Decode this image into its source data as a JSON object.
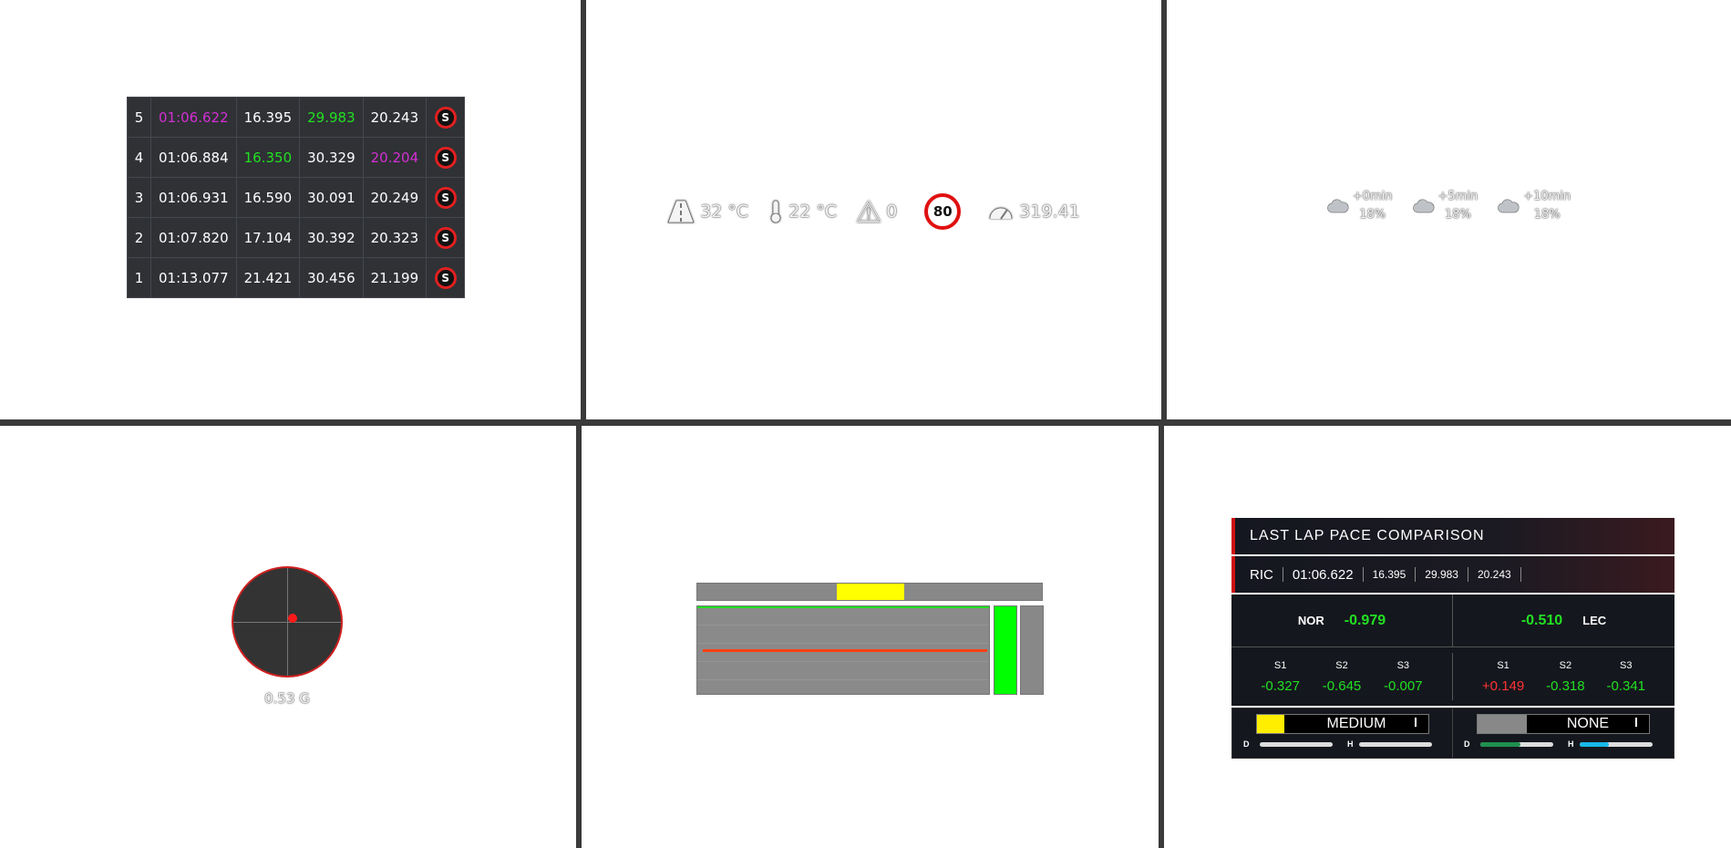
{
  "lap_table": {
    "rows": [
      {
        "lap": "5",
        "time": "01:06.622",
        "s1": "16.395",
        "s2": "29.983",
        "s3": "20.243",
        "time_class": "purple",
        "s1_class": "",
        "s2_class": "green",
        "s3_class": "",
        "tyre": "S"
      },
      {
        "lap": "4",
        "time": "01:06.884",
        "s1": "16.350",
        "s2": "30.329",
        "s3": "20.204",
        "time_class": "",
        "s1_class": "green",
        "s2_class": "",
        "s3_class": "purple",
        "tyre": "S"
      },
      {
        "lap": "3",
        "time": "01:06.931",
        "s1": "16.590",
        "s2": "30.091",
        "s3": "20.249",
        "time_class": "",
        "s1_class": "",
        "s2_class": "",
        "s3_class": "",
        "tyre": "S"
      },
      {
        "lap": "2",
        "time": "01:07.820",
        "s1": "17.104",
        "s2": "30.392",
        "s3": "20.323",
        "time_class": "",
        "s1_class": "",
        "s2_class": "",
        "s3_class": "",
        "tyre": "S"
      },
      {
        "lap": "1",
        "time": "01:13.077",
        "s1": "21.421",
        "s2": "30.456",
        "s3": "21.199",
        "time_class": "",
        "s1_class": "",
        "s2_class": "",
        "s3_class": "",
        "tyre": "S"
      }
    ]
  },
  "weather": {
    "track_temp": "32 °C",
    "air_temp": "22 °C",
    "warnings": "0",
    "speed_limit": "80",
    "speed": "319.41"
  },
  "forecast": [
    {
      "offset": "+0min",
      "rain": "18%"
    },
    {
      "offset": "+5min",
      "rain": "18%"
    },
    {
      "offset": "+10min",
      "rain": "18%"
    }
  ],
  "gforce": {
    "label": "0.53 G"
  },
  "inputs": {
    "steering_fraction": 0.5,
    "throttle_fraction": 1.0,
    "brake_fraction": 0.0,
    "colors": {
      "steer": "#ffff00",
      "throttle": "#00ff00",
      "brake": "#888888"
    }
  },
  "pace": {
    "title": "LAST LAP PACE COMPARISON",
    "ref_driver": "RIC",
    "ref_time": "01:06.622",
    "ref_s1": "16.395",
    "ref_s2": "29.983",
    "ref_s3": "20.243",
    "ahead": {
      "driver": "NOR",
      "delta": "-0.979",
      "s1": "-0.327",
      "s2": "-0.645",
      "s3": "-0.007"
    },
    "behind": {
      "driver": "LEC",
      "delta": "-0.510",
      "s1": "+0.149",
      "s2": "-0.318",
      "s3": "-0.341"
    },
    "sector_labels": [
      "S1",
      "S2",
      "S3"
    ],
    "tyre_left": {
      "name": "MEDIUM",
      "color": "#ffee00",
      "d_fraction": 0,
      "h_fraction": 0
    },
    "tyre_right": {
      "name": "NONE",
      "color": "#888888",
      "d_fraction": 0.55,
      "h_fraction": 0.4
    },
    "wear_labels": {
      "d": "D",
      "h": "H"
    },
    "wear_colors": {
      "d": "#1f8f4e",
      "h": "#18b8e8"
    }
  }
}
